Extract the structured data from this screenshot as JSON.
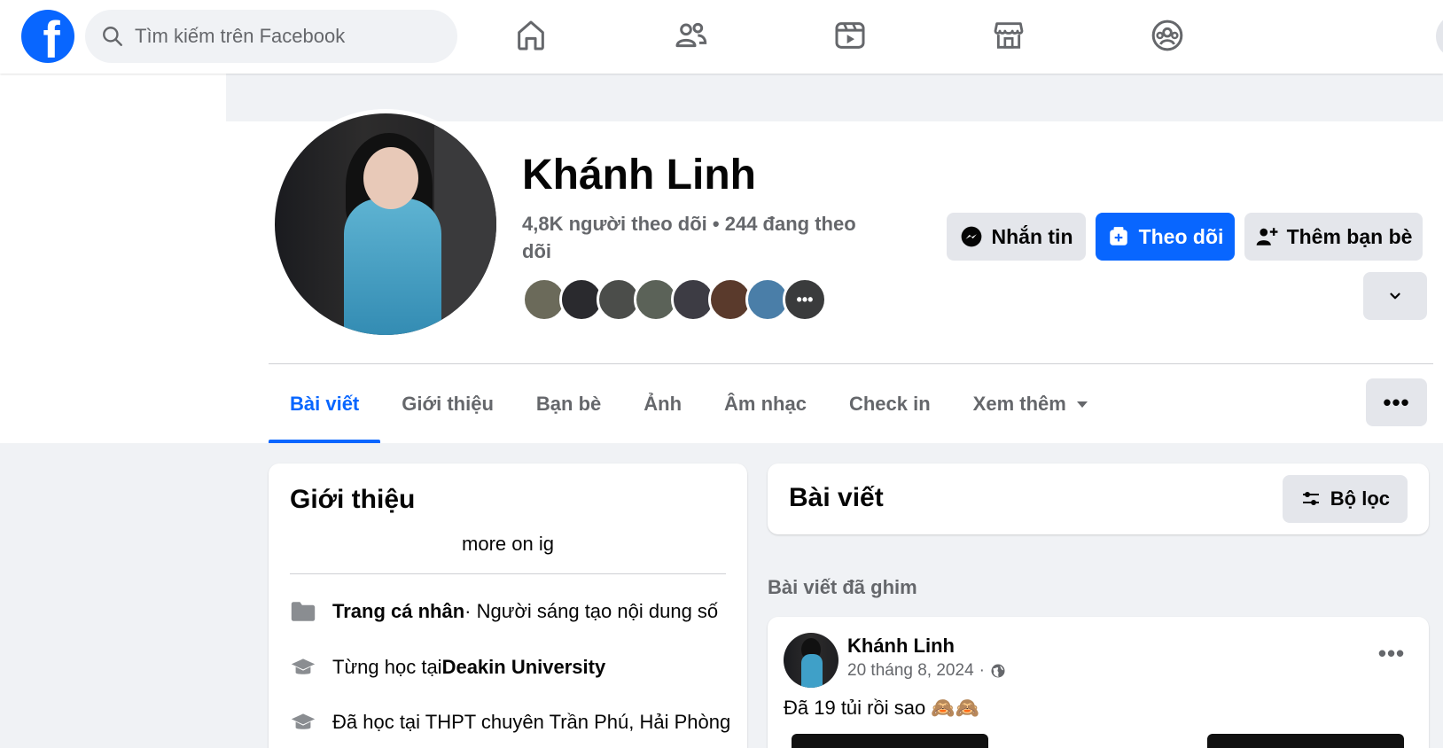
{
  "search": {
    "placeholder": "Tìm kiếm trên Facebook"
  },
  "nav": [
    "home-icon",
    "friends-icon",
    "video-icon",
    "marketplace-icon",
    "groups-icon"
  ],
  "profile": {
    "name": "Khánh Linh",
    "stats": "4,8K người theo dõi • 244 đang theo dõi",
    "friend_avatars_more": "•••"
  },
  "actions": {
    "message": "Nhắn tin",
    "follow": "Theo dõi",
    "add_friend": "Thêm bạn bè"
  },
  "tabs": [
    "Bài viết",
    "Giới thiệu",
    "Bạn bè",
    "Ảnh",
    "Âm nhạc",
    "Check in",
    "Xem thêm"
  ],
  "intro": {
    "title": "Giới thiệu",
    "bio": "more on ig",
    "page_type_label": "Trang cá nhân",
    "page_type_value": " · Người sáng tạo nội dung số",
    "studied_prefix": "Từng học tại ",
    "studied_school": "Deakin University",
    "highschool": "Đã học tại THPT chuyên Trần Phú, Hải Phòng"
  },
  "posts": {
    "title": "Bài viết",
    "filter": "Bộ lọc",
    "pinned": "Bài viết đã ghim",
    "post": {
      "author": "Khánh Linh",
      "date": "20 tháng 8, 2024",
      "separator": "·",
      "text": "Đã 19 tủi rồi sao 🙈🙈"
    }
  },
  "colors": {
    "brand": "#0866ff",
    "background": "#f0f2f5",
    "secondary_text": "#65676b"
  }
}
